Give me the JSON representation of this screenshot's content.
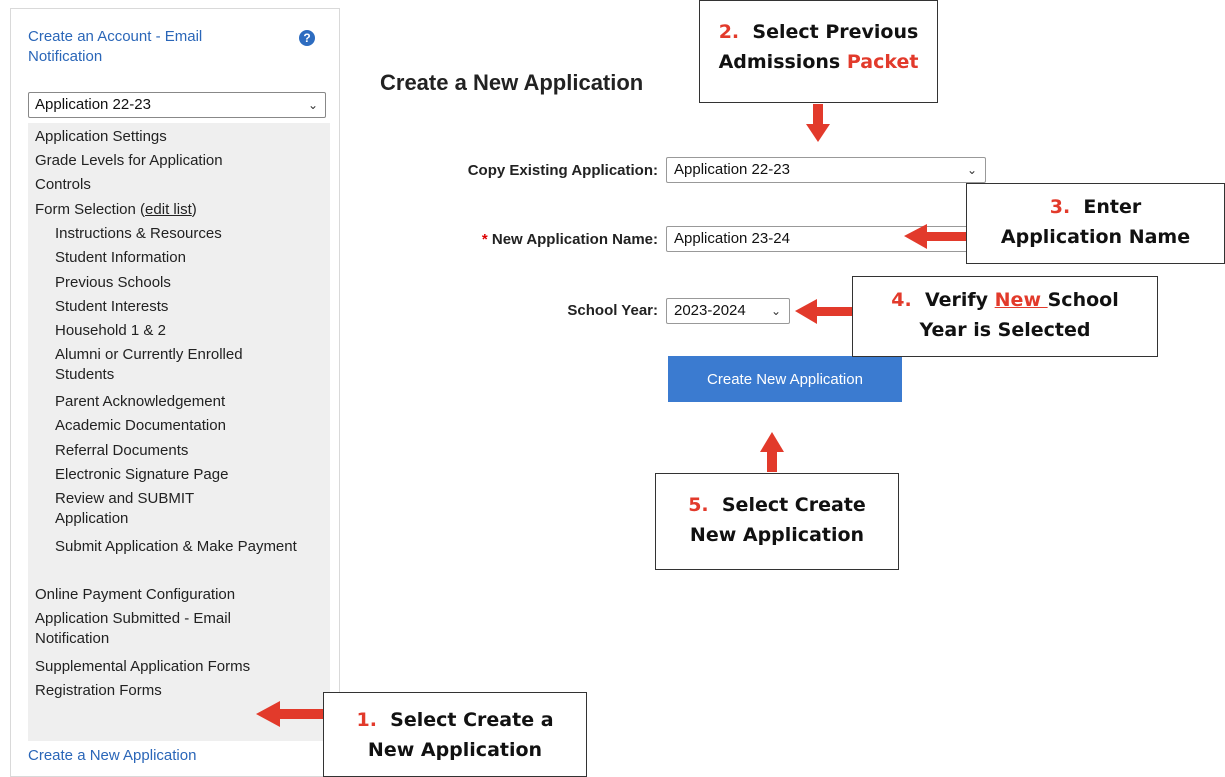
{
  "sidebar": {
    "header_link": "Create an Account - Email Notification",
    "help_icon": "?",
    "app_select": {
      "value": "Application 22-23"
    },
    "items": [
      {
        "label": "Application Settings"
      },
      {
        "label": "Grade Levels for Application"
      },
      {
        "label": "Controls"
      },
      {
        "label": "Form Selection (",
        "link": "edit list",
        "suffix": ")"
      },
      {
        "label": "Instructions & Resources"
      },
      {
        "label": "Student Information"
      },
      {
        "label": "Previous Schools"
      },
      {
        "label": "Student Interests"
      },
      {
        "label": "Household 1 & 2"
      },
      {
        "label": "Alumni or Currently Enrolled Students"
      },
      {
        "label": "Parent Acknowledgement"
      },
      {
        "label": "Academic Documentation"
      },
      {
        "label": "Referral Documents"
      },
      {
        "label": "Electronic Signature Page"
      },
      {
        "label": "Review and SUBMIT Application"
      },
      {
        "label": "Submit Application & Make Payment"
      },
      {
        "label": "Online Payment Configuration"
      },
      {
        "label": "Application Submitted - Email Notification"
      },
      {
        "label": "Supplemental Application Forms"
      },
      {
        "label": "Registration Forms"
      }
    ],
    "footer_link": "Create a New Application"
  },
  "main": {
    "title": "Create a New Application",
    "copy_label": "Copy Existing Application:",
    "copy_value": "Application 22-23",
    "required_mark": "*",
    "name_label": "New Application Name:",
    "name_value": "Application 23-24",
    "year_label": "School Year:",
    "year_value": "2023-2024",
    "create_button": "Create New Application"
  },
  "callouts": {
    "c1": {
      "num": "1.",
      "line1": "Select Create a",
      "line2": "New Application"
    },
    "c2": {
      "num": "2.",
      "line1": "Select Previous",
      "line2a": "Admissions ",
      "line2b": "Packet"
    },
    "c3": {
      "num": "3.",
      "line1": "Enter",
      "line2": "Application Name"
    },
    "c4": {
      "num": "4.",
      "line1a": "Verify ",
      "line1b": "New ",
      "line1c": "School",
      "line2": "Year is Selected"
    },
    "c5": {
      "num": "5.",
      "line1": "Select Create",
      "line2": "New Application"
    }
  },
  "colors": {
    "accent": "#3b7bd0",
    "link": "#2a66b8",
    "annotation_red": "#e23a2b"
  }
}
